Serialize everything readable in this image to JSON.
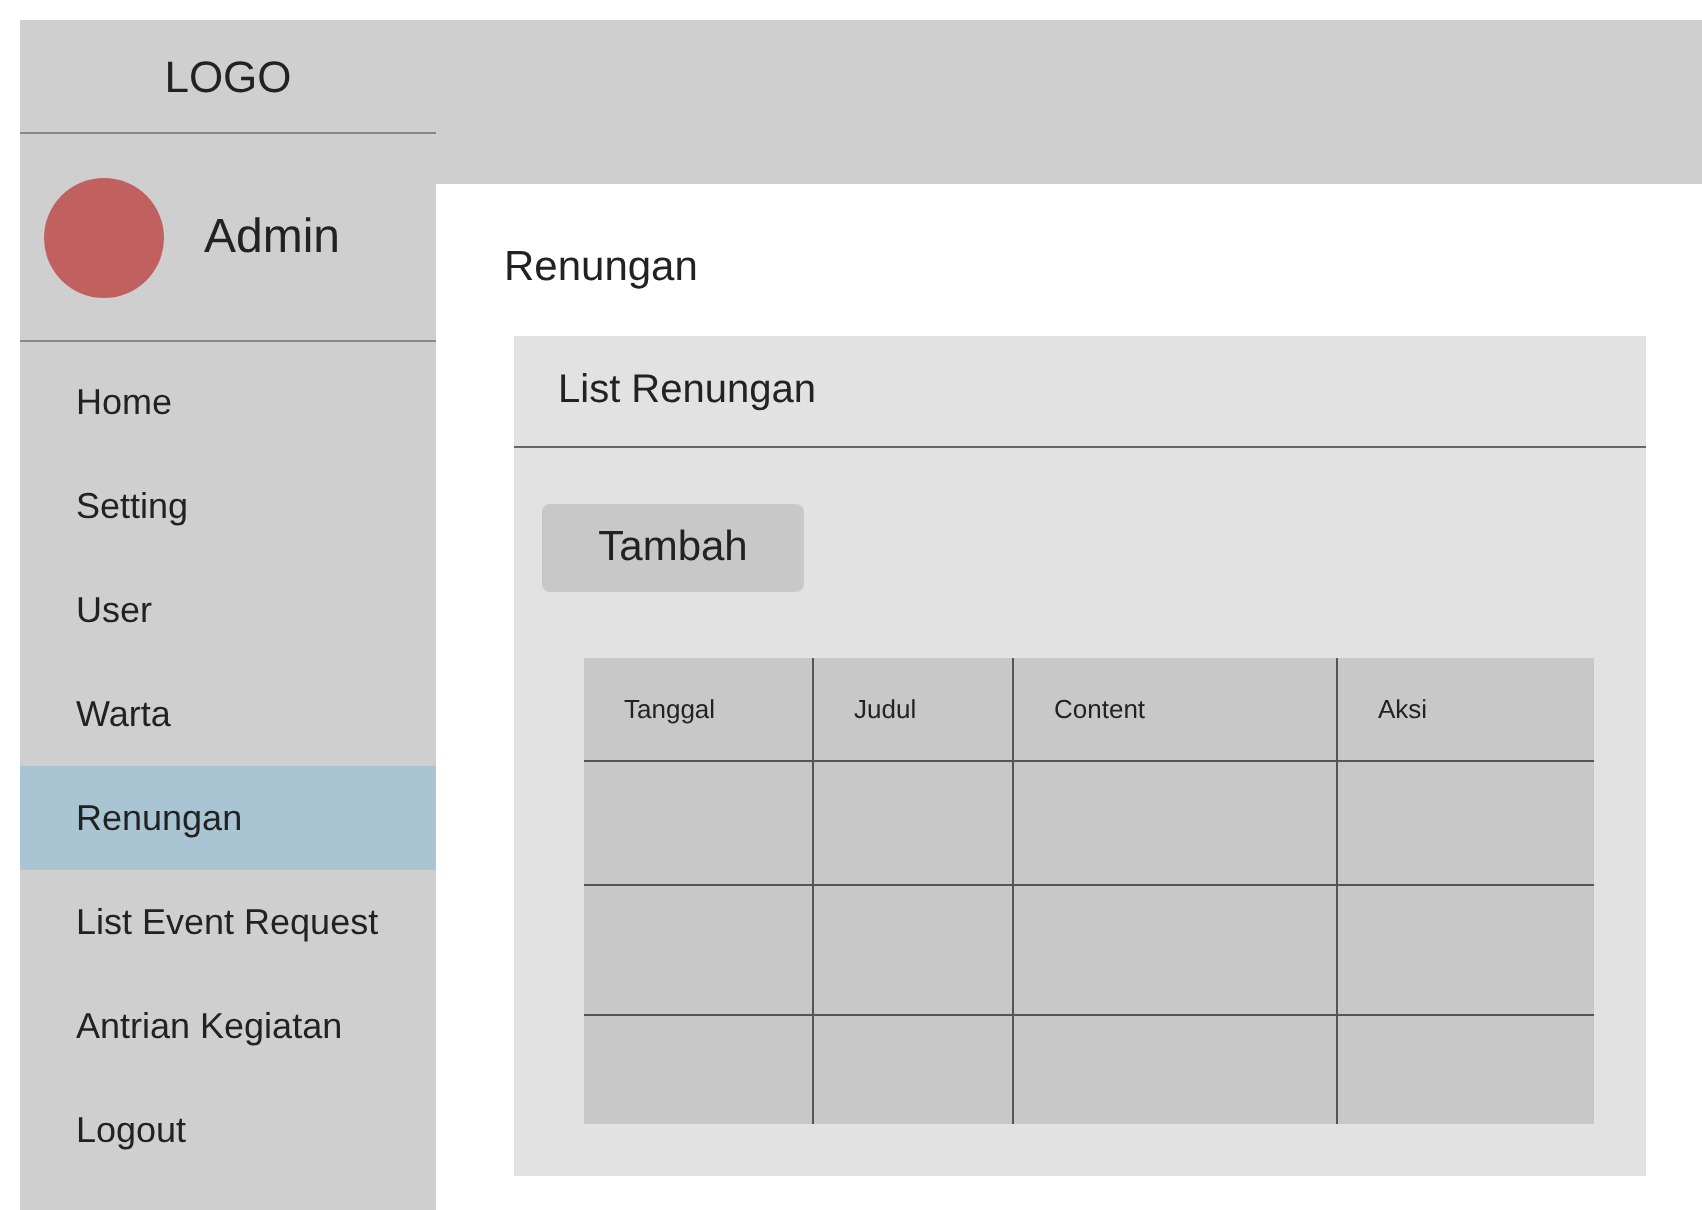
{
  "sidebar": {
    "logo": "LOGO",
    "user": {
      "name": "Admin"
    },
    "items": [
      {
        "label": "Home",
        "selected": false
      },
      {
        "label": "Setting",
        "selected": false
      },
      {
        "label": "User",
        "selected": false
      },
      {
        "label": "Warta",
        "selected": false
      },
      {
        "label": "Renungan",
        "selected": true
      },
      {
        "label": "List Event Request",
        "selected": false
      },
      {
        "label": "Antrian Kegiatan",
        "selected": false
      },
      {
        "label": "Logout",
        "selected": false
      }
    ]
  },
  "page_title": "Renungan",
  "panel": {
    "title": "List Renungan",
    "add_button": "Tambah",
    "table": {
      "columns": [
        "Tanggal",
        "Judul",
        "Content",
        "Aksi"
      ]
    }
  }
}
